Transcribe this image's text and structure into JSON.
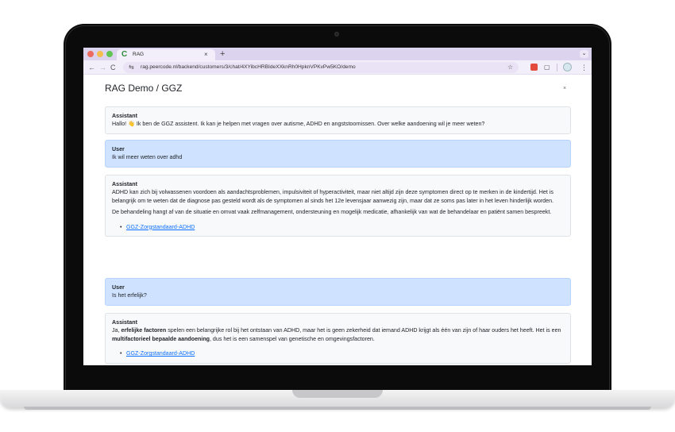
{
  "browser": {
    "tab_title": "RAG",
    "tab_favicon": "C",
    "tab_close": "×",
    "new_tab": "+",
    "tab_menu": "⌄",
    "url": "rag.peercode.nl/backend/customers/3/chat/4XYibcHRBIdeXXknRh0HpknVPKvPw5KO/demo",
    "icons": {
      "back": "←",
      "forward": "→",
      "reload": "C",
      "site_info": "⇆",
      "star": "☆",
      "extension": "",
      "puzzle": "▢",
      "menu": "⋮"
    }
  },
  "page": {
    "title": "RAG Demo / GGZ",
    "close": "×"
  },
  "messages": [
    {
      "role": "Assistant",
      "text": "Hallo! 👋 Ik ben de GGZ assistent. Ik kan je helpen met vragen over autisme, ADHD en angststoornissen. Over welke aandoening wil je meer weten?"
    },
    {
      "role": "User",
      "text": "Ik wil meer weten over adhd"
    },
    {
      "role": "Assistant",
      "p1": "ADHD kan zich bij volwassenen voordoen als aandachtsproblemen, impulsiviteit of hyperactiviteit, maar niet altijd zijn deze symptomen direct op te merken in de kindertijd. Het is belangrijk om te weten dat de diagnose pas gesteld wordt als de symptomen al sinds het 12e levensjaar aanwezig zijn, maar dat ze soms pas later in het leven hinderlijk worden.",
      "p2": "De behandeling hangt af van de situatie en omvat vaak zelfmanagement, ondersteuning en mogelijk medicatie, afhankelijk van wat de behandelaar en patiënt samen bespreekt.",
      "source": "GGZ-Zorgstandaard-ADHD"
    },
    {
      "role": "User",
      "text": "Is het erfelijk?"
    },
    {
      "role": "Assistant",
      "t1": "Ja, ",
      "b1": "erfelijke factoren",
      "t2": " spelen een belangrijke rol bij het ontstaan van ADHD, maar het is geen zekerheid dat iemand ADHD krijgt als één van zijn of haar ouders het heeft. Het is een ",
      "b2": "multifactorieel bepaalde aandoening",
      "t3": ", dus het is een samenspel van genetische en omgevingsfactoren.",
      "source": "GGZ-Zorgstandaard-ADHD"
    }
  ],
  "colors": {
    "tabbar": "#dcd3ef",
    "user_bubble": "#cfe2ff",
    "assistant_bubble": "#f8f9fa",
    "link": "#0d6efd"
  }
}
